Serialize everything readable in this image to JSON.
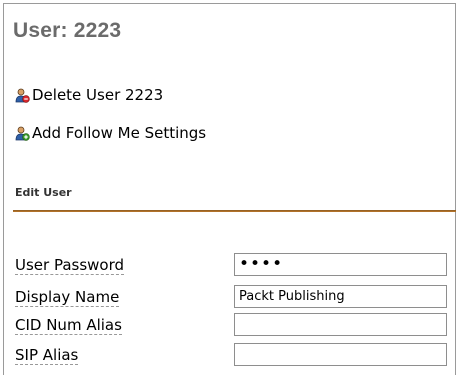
{
  "page": {
    "title": "User: 2223"
  },
  "actions": {
    "delete_label": "Delete User 2223",
    "follow_me_label": "Add Follow Me Settings",
    "icon": "user-icon"
  },
  "section": {
    "heading": "Edit User",
    "rule_color": "#b0702a"
  },
  "form": {
    "password": {
      "label": "User Password",
      "value": "••••"
    },
    "display_name": {
      "label": "Display Name",
      "value": "Packt Publishing"
    },
    "cid_num_alias": {
      "label": "CID Num Alias",
      "value": ""
    },
    "sip_alias": {
      "label": "SIP Alias",
      "value": ""
    }
  }
}
